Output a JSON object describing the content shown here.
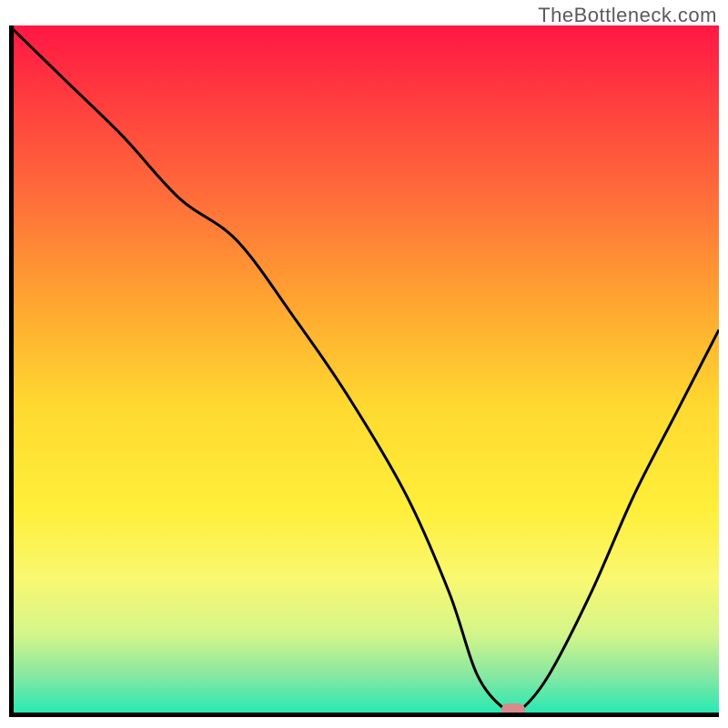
{
  "watermark": "TheBottleneck.com",
  "chart_data": {
    "type": "line",
    "title": "",
    "xlabel": "",
    "ylabel": "",
    "xlim": [
      0,
      100
    ],
    "ylim": [
      0,
      100
    ],
    "grid": false,
    "legend": false,
    "background": {
      "type": "vertical-gradient",
      "stops": [
        {
          "offset": 0.0,
          "color": "#ff1744"
        },
        {
          "offset": 0.1,
          "color": "#ff3a3f"
        },
        {
          "offset": 0.25,
          "color": "#ff6e3a"
        },
        {
          "offset": 0.4,
          "color": "#ffa530"
        },
        {
          "offset": 0.55,
          "color": "#ffd930"
        },
        {
          "offset": 0.7,
          "color": "#ffef3a"
        },
        {
          "offset": 0.8,
          "color": "#f9f871"
        },
        {
          "offset": 0.88,
          "color": "#d4f58a"
        },
        {
          "offset": 0.94,
          "color": "#87e8a1"
        },
        {
          "offset": 1.0,
          "color": "#1de9b6"
        }
      ]
    },
    "series": [
      {
        "name": "bottleneck-curve",
        "color": "#000000",
        "x": [
          0,
          8,
          16,
          24,
          32,
          40,
          48,
          56,
          62,
          66,
          70,
          72,
          76,
          82,
          88,
          94,
          100
        ],
        "y": [
          100,
          92,
          84,
          75,
          69,
          58,
          46,
          32,
          18,
          6,
          1,
          1,
          6,
          18,
          32,
          44,
          56
        ]
      }
    ],
    "marker": {
      "name": "optimal-point",
      "x": 71,
      "y": 1,
      "color": "#d98b8b"
    }
  }
}
